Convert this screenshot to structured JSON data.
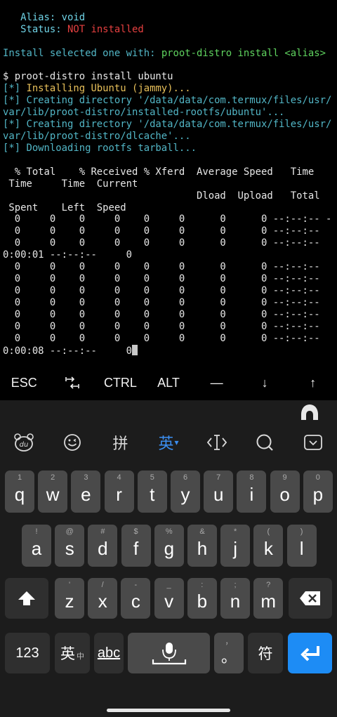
{
  "terminal": {
    "alias_line": "   Alias: void",
    "status_prefix": "   Status: ",
    "status_value": "NOT installed",
    "install_prefix": "Install selected one with: ",
    "install_cmd": "proot-distro install <alias>",
    "cmd_line": "$ proot-distro install ubuntu",
    "msg1_tag": "[*]",
    "msg1_text": " Installing Ubuntu (jammy)...",
    "msg2_a": "[*] Creating directory '/data/data/com.termux/files/usr/",
    "msg2_b": "var/lib/proot-distro/installed-rootfs/ubuntu'...",
    "msg3_a": "[*] Creating directory '/data/data/com.termux/files/usr/",
    "msg3_b": "var/lib/proot-distro/dlcache'...",
    "msg4": "[*] Downloading rootfs tarball...",
    "hdr1": "  % Total    % Received % Xferd  Average Speed   Time",
    "hdr2": " Time     Time  Current",
    "hdr3": "                                 Dload  Upload   Total",
    "hdr4": " Spent    Left  Speed",
    "row1": "  0     0    0     0    0     0      0      0 --:--:-- -",
    "row2": "  0     0    0     0    0     0      0      0 --:--:--",
    "row3": "  0     0    0     0    0     0      0      0 --:--:--",
    "row4": "0:00:01 --:--:--     0",
    "row5": "  0     0    0     0    0     0      0      0 --:--:--",
    "row6": "  0     0    0     0    0     0      0      0 --:--:--",
    "row7": "  0     0    0     0    0     0      0      0 --:--:--",
    "row8": "  0     0    0     0    0     0      0      0 --:--:--",
    "row9": "  0     0    0     0    0     0      0      0 --:--:--",
    "row10": "  0     0    0     0    0     0      0      0 --:--:--",
    "row11": "  0     0    0     0    0     0      0      0 --:--:--",
    "row12": "0:00:08 --:--:--     0"
  },
  "extra_keys": [
    "ESC",
    "⭾",
    "CTRL",
    "ALT",
    "—",
    "↓",
    "↑"
  ],
  "ime_toolbar": {
    "pinyin": "拼",
    "english": "英",
    "english_arrow": "▾"
  },
  "keyboard": {
    "row1": [
      {
        "k": "q",
        "h": "1"
      },
      {
        "k": "w",
        "h": "2"
      },
      {
        "k": "e",
        "h": "3"
      },
      {
        "k": "r",
        "h": "4"
      },
      {
        "k": "t",
        "h": "5"
      },
      {
        "k": "y",
        "h": "6"
      },
      {
        "k": "u",
        "h": "7"
      },
      {
        "k": "i",
        "h": "8"
      },
      {
        "k": "o",
        "h": "9"
      },
      {
        "k": "p",
        "h": "0"
      }
    ],
    "row2": [
      {
        "k": "a",
        "h": "!"
      },
      {
        "k": "s",
        "h": "@"
      },
      {
        "k": "d",
        "h": "#"
      },
      {
        "k": "f",
        "h": "$"
      },
      {
        "k": "g",
        "h": "%"
      },
      {
        "k": "h",
        "h": "&"
      },
      {
        "k": "j",
        "h": "*"
      },
      {
        "k": "k",
        "h": "("
      },
      {
        "k": "l",
        "h": ")"
      }
    ],
    "row3": [
      {
        "k": "z",
        "h": "'"
      },
      {
        "k": "x",
        "h": "/"
      },
      {
        "k": "c",
        "h": "-"
      },
      {
        "k": "v",
        "h": "_"
      },
      {
        "k": "b",
        "h": ":"
      },
      {
        "k": "n",
        "h": ";"
      },
      {
        "k": "m",
        "h": "?"
      }
    ],
    "num_key": "123",
    "lang_key_main": "英",
    "lang_key_sub": "中",
    "abc_key": "abc",
    "punct_key_hint": "，",
    "punct_key": "。",
    "sym_key": "符"
  }
}
